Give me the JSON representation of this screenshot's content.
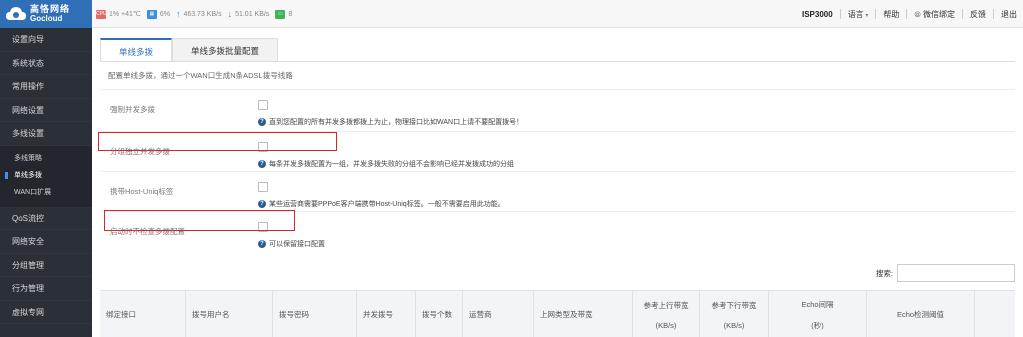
{
  "brand": {
    "name_cn": "高恪网络",
    "name_en": "Gocloud"
  },
  "stats": {
    "cpu": "1% +41℃",
    "mem": "6%",
    "upload": "463.73 KB/s",
    "download": "51.01 KB/s",
    "sessions": "8"
  },
  "topmenu": {
    "model": "ISP3000",
    "language": "语言",
    "help": "帮助",
    "wechat": "微信绑定",
    "feedback": "反馈",
    "logout": "退出"
  },
  "sidebar": {
    "items_top": [
      "设置向导",
      "系统状态",
      "常用操作",
      "网络设置",
      "多线设置"
    ],
    "sub": [
      "多线策略",
      "单线多拨",
      "WAN口扩展"
    ],
    "items_bottom": [
      "QoS流控",
      "网络安全",
      "分组管理",
      "行为管理",
      "虚拟专网"
    ]
  },
  "tabs": [
    "单线多拨",
    "单线多拨批量配置"
  ],
  "description": "配置单线多拨，通过一个WAN口生成N条ADSL拨号线路",
  "options": [
    {
      "label": "强制并发多拨",
      "help": "直到您配置的所有并发多拨都拨上为止，物理接口比如WAN口上请不要配置拨号！"
    },
    {
      "label": "分组独立并发多拨",
      "help": "每条并发多拨配置为一组，并发多拨失败的分组不会影响已经并发拨成功的分组"
    },
    {
      "label": "携带Host-Uniq标签",
      "help": "某些运营商需要PPPoE客户端携带Host-Uniq标签。一般不需要启用此功能。"
    },
    {
      "label": "启动时不检查多拨配置",
      "help": "可以保留接口配置"
    }
  ],
  "search": {
    "label": "搜索:"
  },
  "table": {
    "headers": [
      {
        "line1": "绑定接口"
      },
      {
        "line1": "拨号用户名"
      },
      {
        "line1": "拨号密码"
      },
      {
        "line1": "并发拨号"
      },
      {
        "line1": "拨号个数"
      },
      {
        "line1": "运营商"
      },
      {
        "line1": "上网类型及带宽"
      },
      {
        "line1": "参考上行带宽",
        "line2": "(KB/s)"
      },
      {
        "line1": "参考下行带宽",
        "line2": "(KB/s)"
      },
      {
        "line1": "Echo间隔",
        "line2": "(秒)"
      },
      {
        "line1": "Echo检测阈值"
      }
    ]
  },
  "colors": {
    "accent": "#2f6fb6",
    "sidebar_bg": "#2b2f36",
    "highlight": "#d6262c"
  }
}
